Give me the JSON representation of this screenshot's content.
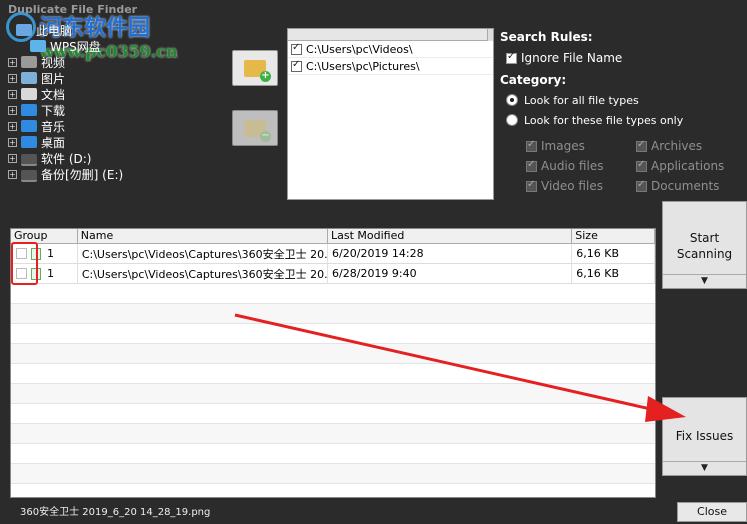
{
  "app": {
    "title": "Duplicate File Finder"
  },
  "watermark": {
    "title": "河东软件园",
    "url": "www.pc0359.cn"
  },
  "tree": [
    {
      "label": "此电脑",
      "icon": "computer-icon"
    },
    {
      "label": "WPS网盘",
      "icon": "cloud-icon"
    },
    {
      "label": "视频",
      "icon": "video-folder-icon"
    },
    {
      "label": "图片",
      "icon": "picture-folder-icon"
    },
    {
      "label": "文档",
      "icon": "document-folder-icon"
    },
    {
      "label": "下载",
      "icon": "download-folder-icon"
    },
    {
      "label": "音乐",
      "icon": "music-folder-icon"
    },
    {
      "label": "桌面",
      "icon": "desktop-folder-icon"
    },
    {
      "label": "软件 (D:)",
      "icon": "drive-icon"
    },
    {
      "label": "备份[勿删] (E:)",
      "icon": "drive-icon"
    }
  ],
  "folders": [
    {
      "path": "C:\\Users\\pc\\Videos\\",
      "checked": true
    },
    {
      "path": "C:\\Users\\pc\\Pictures\\",
      "checked": true
    }
  ],
  "rules": {
    "heading": "Search Rules:",
    "ignore_file_name": "Ignore File Name",
    "category_heading": "Category:",
    "look_all": "Look for all file types",
    "look_these": "Look for these file types only",
    "types": [
      [
        "Images",
        "Archives"
      ],
      [
        "Audio files",
        "Applications"
      ],
      [
        "Video files",
        "Documents"
      ]
    ]
  },
  "grid": {
    "headers": {
      "group": "Group",
      "name": "Name",
      "modified": "Last Modified",
      "size": "Size"
    },
    "rows": [
      {
        "group": "1",
        "name": "C:\\Users\\pc\\Videos\\Captures\\360安全卫士  20...",
        "modified": "6/20/2019 14:28",
        "size": "6,16 KB"
      },
      {
        "group": "1",
        "name": "C:\\Users\\pc\\Videos\\Captures\\360安全卫士  20...",
        "modified": "6/28/2019 9:40",
        "size": "6,16 KB"
      }
    ]
  },
  "buttons": {
    "start_scanning": "Start Scanning",
    "fix_issues": "Fix Issues",
    "close": "Close",
    "dropdown": "▼"
  },
  "status": {
    "text": "360安全卫士  2019_6_20 14_28_19.png"
  },
  "colors": {
    "annotation_red": "#e52020",
    "background": "#2b2b2b"
  }
}
